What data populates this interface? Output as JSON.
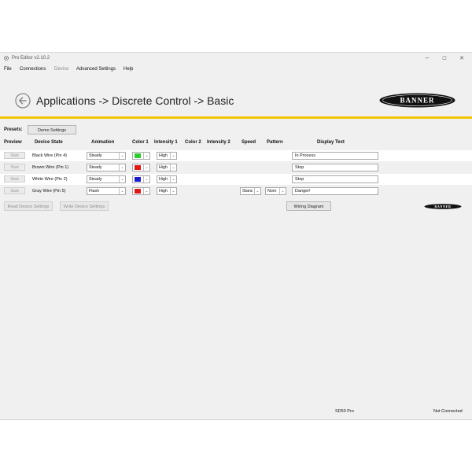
{
  "window": {
    "title": "Pro Editor v2.10.2",
    "controls": {
      "minimize": "–",
      "maximize": "☐",
      "close": "✕"
    }
  },
  "menu": {
    "items": [
      {
        "label": "File",
        "enabled": true
      },
      {
        "label": "Connections",
        "enabled": true
      },
      {
        "label": "Device",
        "enabled": false
      },
      {
        "label": "Advanced Settings",
        "enabled": true
      },
      {
        "label": "Help",
        "enabled": true
      }
    ]
  },
  "header": {
    "breadcrumb": "Applications -> Discrete Control -> Basic",
    "logo_text": "BANNER",
    "accent_color": "#f2c500"
  },
  "presets": {
    "label": "Presets:",
    "button": "Demo Settings"
  },
  "table": {
    "columns": [
      "Preview",
      "Device State",
      "Animation",
      "Color 1",
      "Intensity 1",
      "Color 2",
      "Intensity 2",
      "Speed",
      "Pattern",
      "Display Text"
    ],
    "rows": [
      {
        "preview": "Start",
        "state": "Black Wire (Pin 4)",
        "animation": "Steady",
        "color1": "#2ecc2e",
        "intensity1": "High",
        "speed": "",
        "pattern": "",
        "display_text": "In Process"
      },
      {
        "preview": "Start",
        "state": "Brown Wire (Pin 1)",
        "animation": "Steady",
        "color1": "#e01818",
        "intensity1": "High",
        "speed": "",
        "pattern": "",
        "display_text": "Stop"
      },
      {
        "preview": "Start",
        "state": "White Wire (Pin 2)",
        "animation": "Steady",
        "color1": "#1a1ad0",
        "intensity1": "High",
        "speed": "",
        "pattern": "",
        "display_text": "Stop"
      },
      {
        "preview": "Start",
        "state": "Gray Wire (Pin 5)",
        "animation": "Flash",
        "color1": "#e01818",
        "intensity1": "High",
        "speed": "Stanc",
        "pattern": "Norn",
        "display_text": "Danger!"
      }
    ]
  },
  "actions": {
    "read": "Read Device Settings",
    "write": "Write Device Settings",
    "wiring": "Wiring Diagram"
  },
  "status": {
    "device": "SD50 Pro",
    "connection": "Not Connected"
  }
}
